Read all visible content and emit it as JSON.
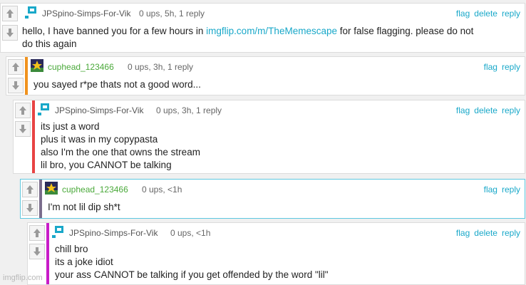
{
  "comments": [
    {
      "username": "JPSpino-Simps-For-Vik",
      "meta": "0 ups, 5h, 1 reply",
      "actions": [
        "flag",
        "delete",
        "reply"
      ],
      "text_before": "hello, I have banned you for a few hours in ",
      "link": "imgflip.com/m/TheMemescape",
      "text_after": " for false flagging. please do not",
      "line2": "do this again"
    },
    {
      "username": "cuphead_123466",
      "meta": "0 ups, 3h, 1 reply",
      "actions": [
        "flag",
        "reply"
      ],
      "lines": [
        "you sayed r*pe thats not a good word..."
      ],
      "accent": "#f0921e"
    },
    {
      "username": "JPSpino-Simps-For-Vik",
      "meta": "0 ups, 3h, 1 reply",
      "actions": [
        "flag",
        "delete",
        "reply"
      ],
      "lines": [
        "its just a word",
        "plus it was in my copypasta",
        "also I'm the one that owns the stream",
        "lil bro, you CANNOT be talking"
      ],
      "accent": "#e84343"
    },
    {
      "username": "cuphead_123466",
      "meta": "0 ups, <1h",
      "actions": [
        "flag",
        "reply"
      ],
      "lines": [
        "I'm not lil dip sh*t"
      ],
      "accent": "#7b6d8d"
    },
    {
      "username": "JPSpino-Simps-For-Vik",
      "meta": "0 ups, <1h",
      "actions": [
        "flag",
        "delete",
        "reply"
      ],
      "lines": [
        "chill bro",
        "its a joke idiot",
        "your ass CANNOT be talking if you get offended by the word \"lil\""
      ],
      "accent": "#c81cc8"
    }
  ],
  "watermark": "imgflip.com"
}
